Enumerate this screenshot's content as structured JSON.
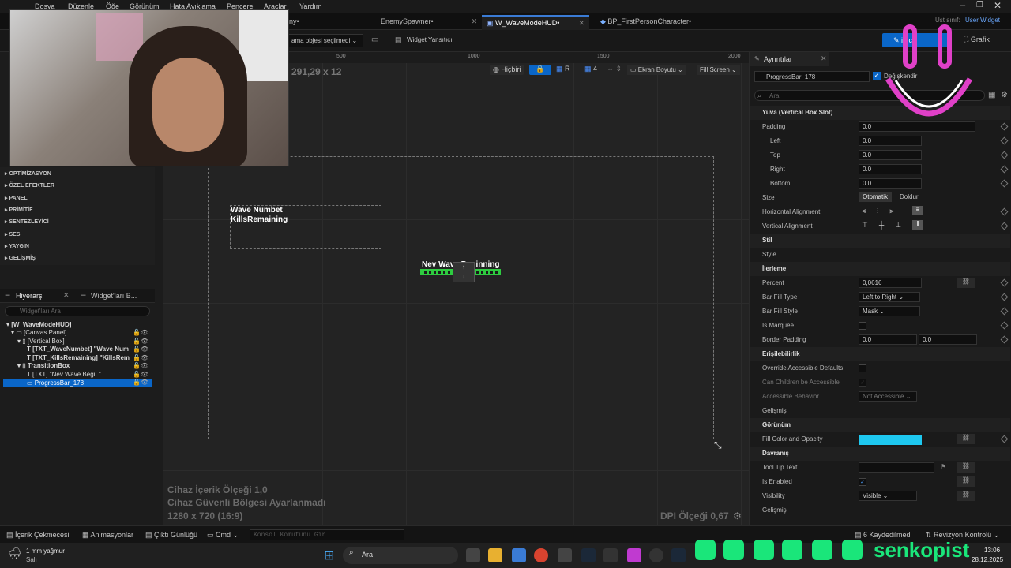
{
  "menu": [
    "Dosya",
    "Düzenle",
    "Öğe",
    "Görünüm",
    "Hata Ayıklama",
    "Pencere",
    "Araçlar",
    "Yardım"
  ],
  "tabs": [
    {
      "label": "ny•"
    },
    {
      "label": "EnemySpawner•"
    },
    {
      "label": "W_WaveModeHUD•"
    },
    {
      "label": "BP_FirstPersonCharacter•"
    }
  ],
  "parent_class": {
    "label": "Üst sınıf:",
    "value": "User Widget"
  },
  "toolbar": {
    "selection": "ama objesi seçilmedi",
    "reflector": "Widget Yansıtıcı",
    "designer": "imci",
    "graph": "Grafik"
  },
  "viewport": {
    "coords": "291,29 x 12",
    "ruler": [
      "500",
      "1000",
      "1500",
      "2000"
    ],
    "none_btn": "Hiçbiri",
    "r_btn": "R",
    "four": "4",
    "screen_size": "Ekran Boyutu",
    "fill_screen": "Fill Screen",
    "text1": "Wave Numbet",
    "text2": "KillsRemaining",
    "text3": "Nev Wave Beginning",
    "scale": "Cihaz İçerik Ölçeği 1,0",
    "safe_zone": "Cihaz Güvenli Bölgesi Ayarlanmadı",
    "resolution": "1280 x 720 (16:9)",
    "dpi": "DPI Ölçeği 0,67"
  },
  "palette_categories": [
    "OPTİMİZASYON",
    "ÖZEL EFEKTLER",
    "PANEL",
    "PRİMİTİF",
    "SENTEZLEYİCİ",
    "SES",
    "YAYGIN",
    "GELİŞMİŞ"
  ],
  "hierarchy": {
    "tab1": "Hiyerarşi",
    "tab2": "Widget'ları B...",
    "search_placeholder": "Widget'ları Ara",
    "items": [
      "[W_WaveModeHUD]",
      "[Canvas Panel]",
      "[Vertical Box]",
      "[TXT_WaveNumbet] \"Wave Num",
      "[TXT_KillsRemaining] \"KillsRem",
      "TransitionBox",
      "[TXT] \"Nev Wave Begi..\"",
      "ProgressBar_178"
    ]
  },
  "details": {
    "title": "Ayrıntılar",
    "widget_name": "ProgressBar_178",
    "is_variable": "Değişkendir",
    "search_placeholder": "Ara",
    "slot_section": "Yuva (Vertical Box Slot)",
    "padding_label": "Padding",
    "padding_value": "0.0",
    "left_label": "Left",
    "left_value": "0.0",
    "top_label": "Top",
    "top_value": "0.0",
    "right_label": "Right",
    "right_value": "0.0",
    "bottom_label": "Bottom",
    "bottom_value": "0.0",
    "size_label": "Size",
    "size_auto": "Otomatik",
    "size_fill": "Doldur",
    "h_align": "Horizontal Alignment",
    "v_align": "Vertical Alignment",
    "style_section": "Stil",
    "style_label": "Style",
    "progress_section": "İlerleme",
    "percent_label": "Percent",
    "percent_value": "0,0616",
    "fill_type_label": "Bar Fill Type",
    "fill_type_value": "Left to Right",
    "fill_style_label": "Bar Fill Style",
    "fill_style_value": "Mask",
    "marquee_label": "Is Marquee",
    "border_padding_label": "Border Padding",
    "border_padding_x": "0,0",
    "border_padding_y": "0,0",
    "access_section": "Erişilebilirlik",
    "override_label": "Override Accessible Defaults",
    "children_label": "Can Children be Accessible",
    "behavior_label": "Accessible Behavior",
    "behavior_value": "Not Accessible",
    "advanced1": "Gelişmiş",
    "appearance_section": "Görünüm",
    "fill_color_label": "Fill Color and Opacity",
    "fill_color": "#1ec8f0",
    "behavior_section": "Davranış",
    "tooltip_label": "Tool Tip Text",
    "enabled_label": "Is Enabled",
    "visibility_label": "Visibility",
    "visibility_value": "Visible",
    "advanced2": "Gelişmiş"
  },
  "statusbar": {
    "content": "İçerik Çekmecesi",
    "anim": "Animasyonlar",
    "output": "Çıktı Günlüğü",
    "cmd": "Cmd",
    "console_placeholder": "Konsol Komutunu Gir",
    "saved": "6 Kaydedilmedi",
    "revision": "Revizyon Kontrolü"
  },
  "taskbar": {
    "weather_temp": "1 mm yağmur",
    "weather_day": "Salı",
    "search": "Ara",
    "time": "13:06",
    "date": "28.12.2025"
  },
  "social": {
    "handle": "senkopist"
  },
  "colors": {
    "accent": "#3a7bd5",
    "selection": "#0a66c8",
    "social_green": "#1ae67a",
    "smile": "#e040c8"
  }
}
